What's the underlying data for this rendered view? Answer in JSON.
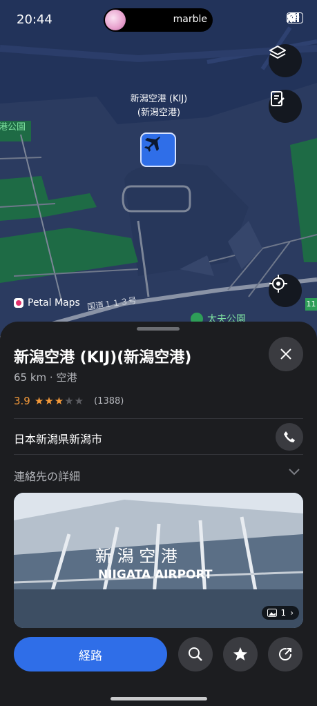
{
  "status_bar": {
    "time": "20:44",
    "notification_name": "marble",
    "battery": "99"
  },
  "map": {
    "brand": "Petal Maps",
    "airport_label_line1": "新潟空港 (KIJ)",
    "airport_label_line2": "(新潟空港)",
    "park_left": "港公園",
    "road_label": "国道１１３号",
    "park_bottom": "太夫公園",
    "route_badge": "11",
    "colors": {
      "water": "#22335a",
      "land": "#2d3d63",
      "green": "#1e6b45",
      "road": "#7d8698"
    }
  },
  "sheet": {
    "title": "新潟空港 (KIJ)(新潟空港)",
    "meta": "65 km · 空港",
    "rating": "3.9",
    "stars_filled": 3,
    "stars_total": 5,
    "review_count": "(1388)",
    "address": "日本新潟県新潟市",
    "contact_label": "連絡先の詳細",
    "photo_count": "1",
    "photo_sign_jp": "新 潟 空 港",
    "photo_sign_en": "NIIGATA AIRPORT"
  },
  "actions": {
    "route_label": "経路"
  },
  "icons": [
    "layers-icon",
    "notes-icon",
    "locate-icon",
    "airplane-icon",
    "close-icon",
    "phone-icon",
    "chevron-down-icon",
    "image-icon",
    "search-icon",
    "star-icon",
    "share-icon"
  ],
  "accent": "#2f6ee8",
  "rating_color": "#f59a3a"
}
